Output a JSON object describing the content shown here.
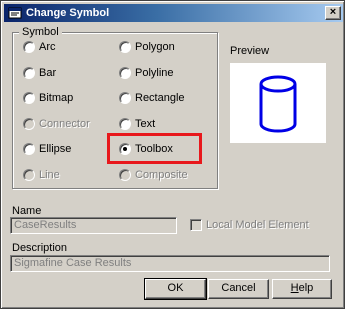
{
  "window": {
    "title": "Change Symbol",
    "close_glyph": "×"
  },
  "symbol_group": {
    "label": "Symbol",
    "options": [
      {
        "label": "Arc",
        "checked": false,
        "enabled": true
      },
      {
        "label": "Polygon",
        "checked": false,
        "enabled": true
      },
      {
        "label": "Bar",
        "checked": false,
        "enabled": true
      },
      {
        "label": "Polyline",
        "checked": false,
        "enabled": true
      },
      {
        "label": "Bitmap",
        "checked": false,
        "enabled": true
      },
      {
        "label": "Rectangle",
        "checked": false,
        "enabled": true
      },
      {
        "label": "Connector",
        "checked": false,
        "enabled": false
      },
      {
        "label": "Text",
        "checked": false,
        "enabled": true
      },
      {
        "label": "Ellipse",
        "checked": false,
        "enabled": true
      },
      {
        "label": "Toolbox",
        "checked": true,
        "enabled": true
      },
      {
        "label": "Line",
        "checked": false,
        "enabled": false
      },
      {
        "label": "Composite",
        "checked": false,
        "enabled": false
      }
    ]
  },
  "preview": {
    "label": "Preview",
    "shape_color": "#0000e6"
  },
  "name": {
    "label": "Name",
    "value": "CaseResults"
  },
  "local_model_element": {
    "label": "Local Model Element",
    "checked": false
  },
  "description": {
    "label": "Description",
    "value": "Sigmafine Case Results"
  },
  "buttons": {
    "ok": "OK",
    "cancel": "Cancel",
    "help_prefix": "H",
    "help_rest": "elp"
  },
  "highlight_color": "#e8181c"
}
